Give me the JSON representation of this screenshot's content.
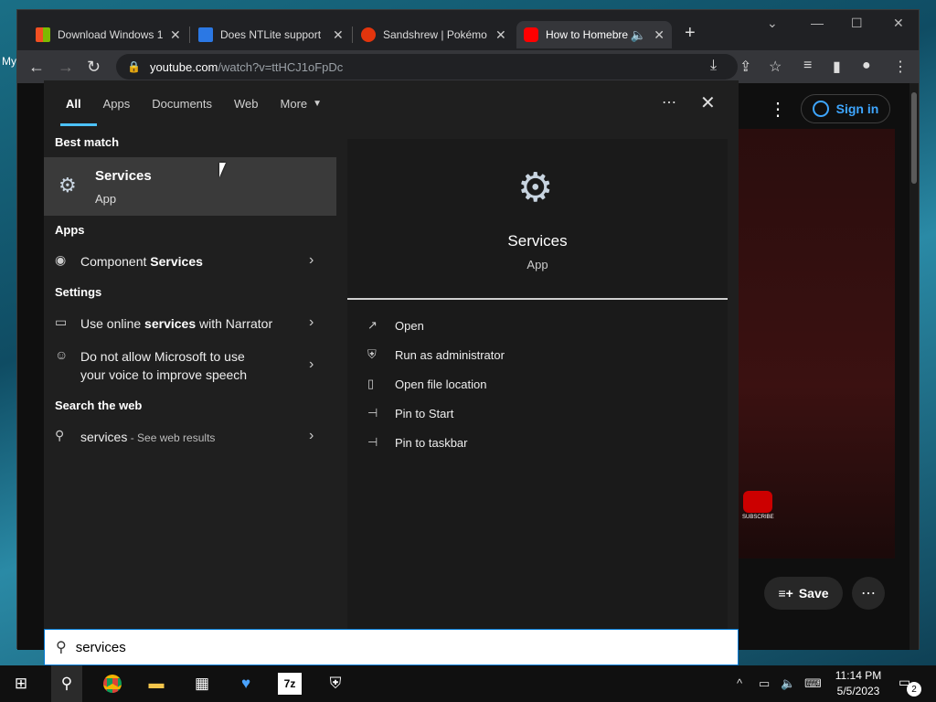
{
  "desktop": {
    "label": "My"
  },
  "browser": {
    "tabs": [
      {
        "title": "Download Windows 1",
        "color": "#f25022"
      },
      {
        "title": "Does NTLite support",
        "color": "#2b78e4"
      },
      {
        "title": "Sandshrew | Pokémo",
        "color": "#e3350d"
      },
      {
        "title": "How to Homebre",
        "color": "#ff0000"
      }
    ],
    "url_host": "youtube.com",
    "url_path": "/watch?v=ttHCJ1oFpDc"
  },
  "youtube": {
    "sign_in": "Sign in",
    "save": "Save",
    "subscribe": "SUBSCRIBE"
  },
  "search": {
    "tabs": [
      "All",
      "Apps",
      "Documents",
      "Web",
      "More"
    ],
    "best_match_header": "Best match",
    "best_match": {
      "name": "Services",
      "kind": "App"
    },
    "apps_header": "Apps",
    "apps": [
      {
        "pre": "Component ",
        "bold": "Services"
      }
    ],
    "settings_header": "Settings",
    "settings": [
      {
        "pre": "Use online ",
        "bold": "services",
        "post": " with Narrator"
      },
      {
        "text": "Do not allow Microsoft to use your voice to improve speech"
      }
    ],
    "web_header": "Search the web",
    "web": {
      "query": "services",
      "suffix": " - See web results"
    },
    "preview": {
      "name": "Services",
      "kind": "App",
      "actions": [
        "Open",
        "Run as administrator",
        "Open file location",
        "Pin to Start",
        "Pin to taskbar"
      ]
    },
    "query": "services"
  },
  "taskbar": {
    "time": "11:14 PM",
    "date": "5/5/2023",
    "notifications": "2"
  }
}
